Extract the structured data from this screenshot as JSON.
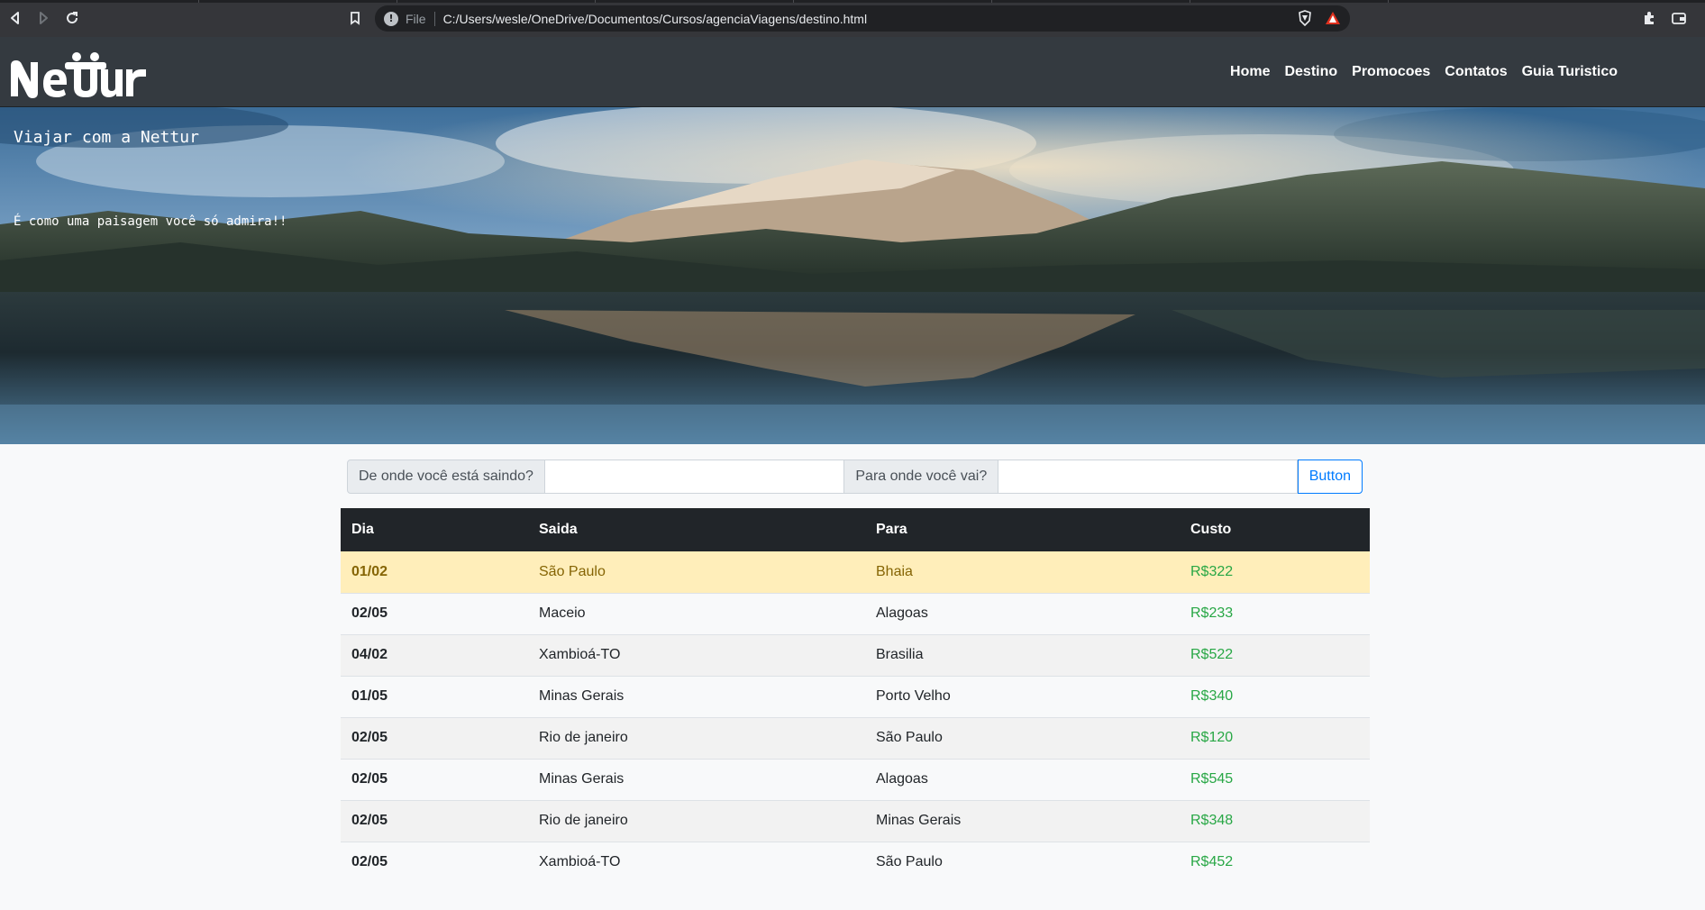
{
  "browser": {
    "scheme_label": "File",
    "url": "C:/Users/wesle/OneDrive/Documentos/Cursos/agenciaViagens/destino.html"
  },
  "site": {
    "logo": "NeTTur",
    "nav": [
      "Home",
      "Destino",
      "Promocoes",
      "Contatos",
      "Guia Turistico"
    ]
  },
  "hero": {
    "title": "Viajar com a Nettur",
    "subtitle": "É como uma paisagem você só admira!!"
  },
  "search": {
    "from_label": "De onde você está saindo?",
    "from_value": "",
    "to_label": "Para onde você vai?",
    "to_value": "",
    "button": "Button"
  },
  "table": {
    "headers": [
      "Dia",
      "Saida",
      "Para",
      "Custo"
    ],
    "rows": [
      [
        "01/02",
        "São Paulo",
        "Bhaia",
        "R$322"
      ],
      [
        "02/05",
        "Maceio",
        "Alagoas",
        "R$233"
      ],
      [
        "04/02",
        "Xambioá-TO",
        "Brasilia",
        "R$522"
      ],
      [
        "01/05",
        "Minas Gerais",
        "Porto Velho",
        "R$340"
      ],
      [
        "02/05",
        "Rio de janeiro",
        "São Paulo",
        "R$120"
      ],
      [
        "02/05",
        "Minas Gerais",
        "Alagoas",
        "R$545"
      ],
      [
        "02/05",
        "Rio de janeiro",
        "Minas Gerais",
        "R$348"
      ],
      [
        "02/05",
        "Xambioá-TO",
        "São Paulo",
        "R$452"
      ]
    ],
    "highlighted_row": 0
  },
  "colors": {
    "navbar": "#343a40",
    "table_header": "#212529",
    "highlight_row": "#ffeeba",
    "cost_text": "#28a745",
    "primary": "#007bff"
  }
}
